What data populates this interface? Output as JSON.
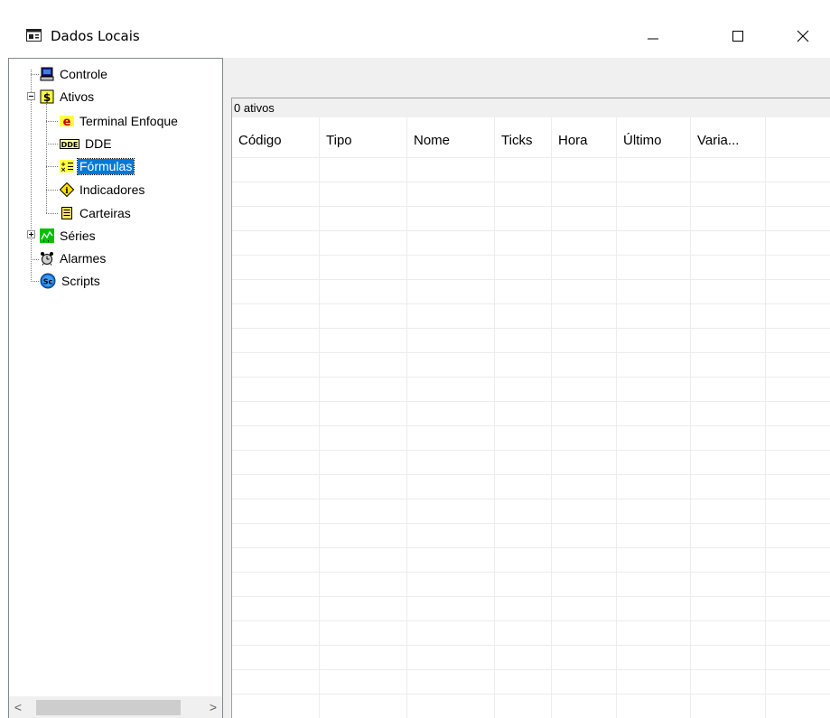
{
  "window": {
    "title": "Dados Locais",
    "minimize_glyph": "—",
    "maximize_glyph": "☐",
    "close_glyph": "✕"
  },
  "tree": {
    "items": [
      {
        "label": "Controle",
        "icon": "computer-icon"
      },
      {
        "label": "Ativos",
        "icon": "dollar-icon",
        "expander": "-"
      },
      {
        "label": "Terminal Enfoque",
        "icon": "enfoque-e-icon"
      },
      {
        "label": "DDE",
        "icon": "dde-icon"
      },
      {
        "label": "Fórmulas",
        "icon": "formula-icon",
        "selected": true
      },
      {
        "label": "Indicadores",
        "icon": "indicator-diamond-icon"
      },
      {
        "label": "Carteiras",
        "icon": "portfolio-icon"
      },
      {
        "label": "Séries",
        "icon": "chart-series-icon",
        "expander": "+"
      },
      {
        "label": "Alarmes",
        "icon": "alarm-clock-icon"
      },
      {
        "label": "Scripts",
        "icon": "scripts-sc-icon"
      }
    ],
    "scroll_left_glyph": "<",
    "scroll_right_glyph": ">"
  },
  "status": {
    "text": "0 ativos"
  },
  "table": {
    "columns": [
      "Código",
      "Tipo",
      "Nome",
      "Ticks",
      "Hora",
      "Último",
      "Varia..."
    ],
    "rows": []
  },
  "colors": {
    "selection": "#0078d7",
    "panel_bg": "#f0f0f0",
    "grid_line": "#ececec"
  }
}
